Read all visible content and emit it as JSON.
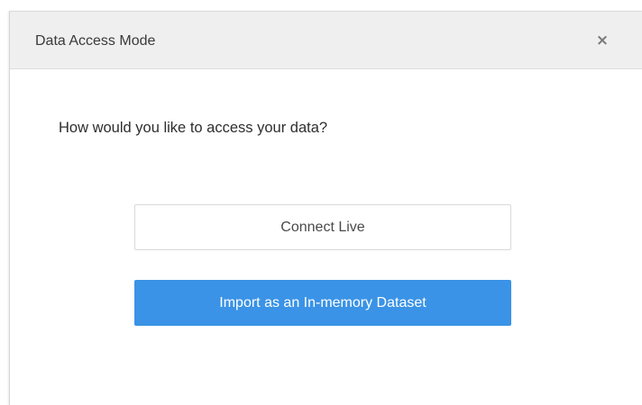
{
  "dialog": {
    "title": "Data Access Mode",
    "close_label": "×"
  },
  "body": {
    "question": "How would you like to access your data?"
  },
  "options": {
    "connect_live_label": "Connect Live",
    "import_label": "Import as an In-memory Dataset"
  },
  "colors": {
    "primary_button": "#3a93e6",
    "header_background": "#efefef"
  },
  "icons": {
    "close": "close-icon"
  }
}
